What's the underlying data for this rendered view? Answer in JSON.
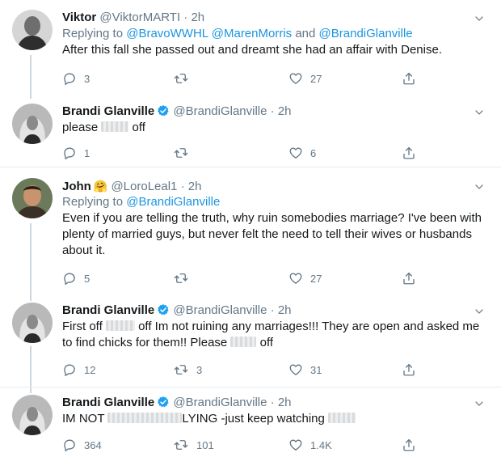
{
  "tweets": [
    {
      "name": "Viktor",
      "handle": "@ViktorMARTI",
      "dot": "·",
      "time": "2h",
      "verified": false,
      "reply_prefix": "Replying to ",
      "reply_to_1": "@BravoWWHL",
      "reply_to_2": "@MarenMorris",
      "reply_join": " and ",
      "reply_to_3": "@BrandiGlanville",
      "text": "After this fall she passed out and dreamt she had an affair with Denise.",
      "comments": "3",
      "retweets": "",
      "likes": "27"
    },
    {
      "name": "Brandi Glanville",
      "handle": "@BrandiGlanville",
      "dot": "·",
      "time": "2h",
      "verified": true,
      "text_a": "please ",
      "text_b": " off",
      "comments": "1",
      "retweets": "",
      "likes": "6"
    },
    {
      "name": "John",
      "emoji": "🤗",
      "handle": "@LoroLeal1",
      "dot": "·",
      "time": "2h",
      "verified": false,
      "reply_prefix": "Replying to ",
      "reply_to_1": "@BrandiGlanville",
      "text": "Even if you are telling the truth, why ruin somebodies marriage? I've been with plenty of married guys, but never felt the need to tell their wives or husbands about it.",
      "comments": "5",
      "retweets": "",
      "likes": "27"
    },
    {
      "name": "Brandi Glanville",
      "handle": "@BrandiGlanville",
      "dot": "·",
      "time": "2h",
      "verified": true,
      "text_a": "First off ",
      "text_b": " off Im not ruining any marriages!!! They are open and asked me to find chicks for them!! Please ",
      "text_c": " off",
      "comments": "12",
      "retweets": "3",
      "likes": "31"
    },
    {
      "name": "Brandi Glanville",
      "handle": "@BrandiGlanville",
      "dot": "·",
      "time": "2h",
      "verified": true,
      "text_a": "IM NOT ",
      "text_b": "LYING -just keep watching ",
      "comments": "364",
      "retweets": "101",
      "likes": "1.4K"
    }
  ],
  "icons": {
    "comment": "comment-icon",
    "retweet": "retweet-icon",
    "like": "heart-icon",
    "share": "share-icon",
    "caret": "chevron-down-icon",
    "verified": "verified-badge-icon"
  },
  "colors": {
    "link": "#1b95e0",
    "secondary_text": "#657786",
    "verified": "#1da1f2",
    "divider": "#e6ecf0"
  }
}
